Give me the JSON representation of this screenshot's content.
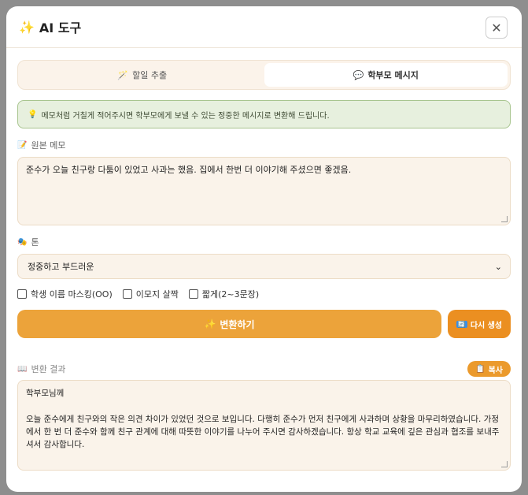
{
  "modal": {
    "title_icon": "✨",
    "title": "AI 도구",
    "close_icon": "✕"
  },
  "tabs": [
    {
      "icon": "🪄",
      "label": "할일 추출",
      "active": false
    },
    {
      "icon": "💬",
      "label": "학부모 메시지",
      "active": true
    }
  ],
  "notice": {
    "icon": "💡",
    "text": "메모처럼 거칠게 적어주시면 학부모에게 보낼 수 있는 정중한 메시지로 변환해 드립니다."
  },
  "memo": {
    "icon": "📝",
    "label": "원본 메모",
    "value": "준수가 오늘 친구랑 다툼이 있었고 사과는 했음. 집에서 한번 더 이야기해 주셨으면 좋겠음."
  },
  "tone": {
    "icon": "🎭",
    "label": "톤",
    "selected": "정중하고 부드러운"
  },
  "options": [
    {
      "label": "학생 이름 마스킹(OO)",
      "checked": false
    },
    {
      "label": "이모지 살짝",
      "checked": false
    },
    {
      "label": "짧게(2~3문장)",
      "checked": false
    }
  ],
  "actions": {
    "convert_icon": "✨",
    "convert_label": "변환하기",
    "regen_icon": "🔄",
    "regen_label": "다시 생성"
  },
  "result": {
    "icon": "📖",
    "label": "변환 결과",
    "copy_icon": "📋",
    "copy_label": "복사",
    "value": "학부모님께\n\n오늘 준수에게 친구와의 작은 의견 차이가 있었던 것으로 보입니다. 다행히 준수가 먼저 친구에게 사과하며 상황을 마무리하였습니다. 가정에서 한 번 더 준수와 함께 친구 관계에 대해 따뜻한 이야기를 나누어 주시면 감사하겠습니다. 항상 학교 교육에 깊은 관심과 협조를 보내주셔서 감사합니다."
  }
}
